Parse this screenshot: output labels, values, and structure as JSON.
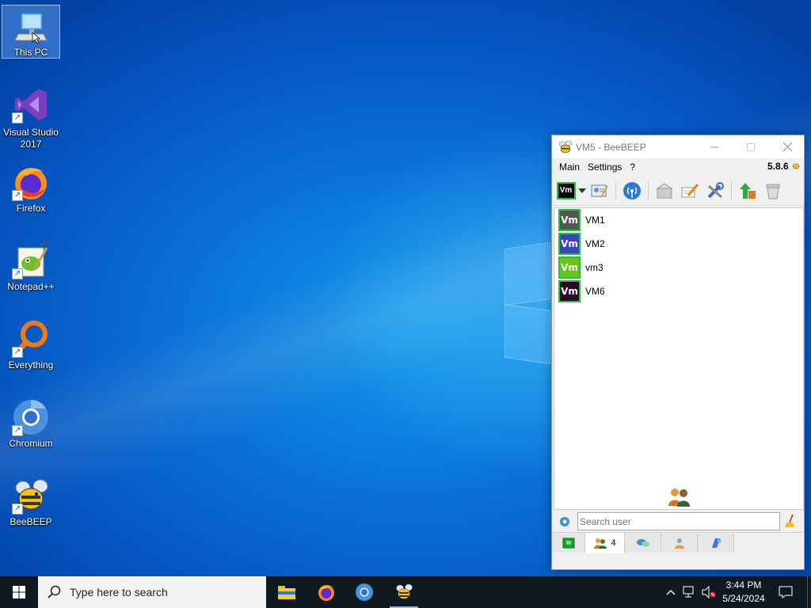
{
  "desktop": {
    "icons": [
      {
        "label": "This PC",
        "icon": "computer-icon"
      },
      {
        "label": "Visual Studio\n2017",
        "icon": "visual-studio-icon"
      },
      {
        "label": "Firefox",
        "icon": "firefox-icon"
      },
      {
        "label": "Notepad++",
        "icon": "notepadpp-icon"
      },
      {
        "label": "Everything",
        "icon": "everything-icon"
      },
      {
        "label": "Chromium",
        "icon": "chromium-icon"
      },
      {
        "label": "BeeBEEP",
        "icon": "beebeep-icon"
      }
    ]
  },
  "window": {
    "title": "VM5 - BeeBEEP",
    "version": "5.8.6",
    "menu": [
      "Main",
      "Settings",
      "?"
    ],
    "status_avatar_text": "Vm",
    "users": [
      {
        "avatar": "Vm",
        "name": "VM1",
        "color": "#555555"
      },
      {
        "avatar": "Vm",
        "name": "VM2",
        "color": "#3a46b8"
      },
      {
        "avatar": "Vm",
        "name": "vm3",
        "color": "#6cc21a"
      },
      {
        "avatar": "Vm",
        "name": "VM6",
        "color": "#2a0a24"
      }
    ],
    "search_placeholder": "Search user",
    "tabs": [
      {
        "icon": "status-icon",
        "label": ""
      },
      {
        "icon": "users-icon",
        "label": "4"
      },
      {
        "icon": "chat-icon",
        "label": ""
      },
      {
        "icon": "groups-icon",
        "label": ""
      },
      {
        "icon": "shares-icon",
        "label": ""
      }
    ]
  },
  "taskbar": {
    "search_placeholder": "Type here to search",
    "apps": [
      "file-explorer-icon",
      "firefox-icon",
      "chromium-icon",
      "beebeep-icon"
    ],
    "time": "3:44 PM",
    "date": "5/24/2024"
  },
  "colors": {
    "online_border": "#22c33a",
    "taskbar": "#101820"
  }
}
